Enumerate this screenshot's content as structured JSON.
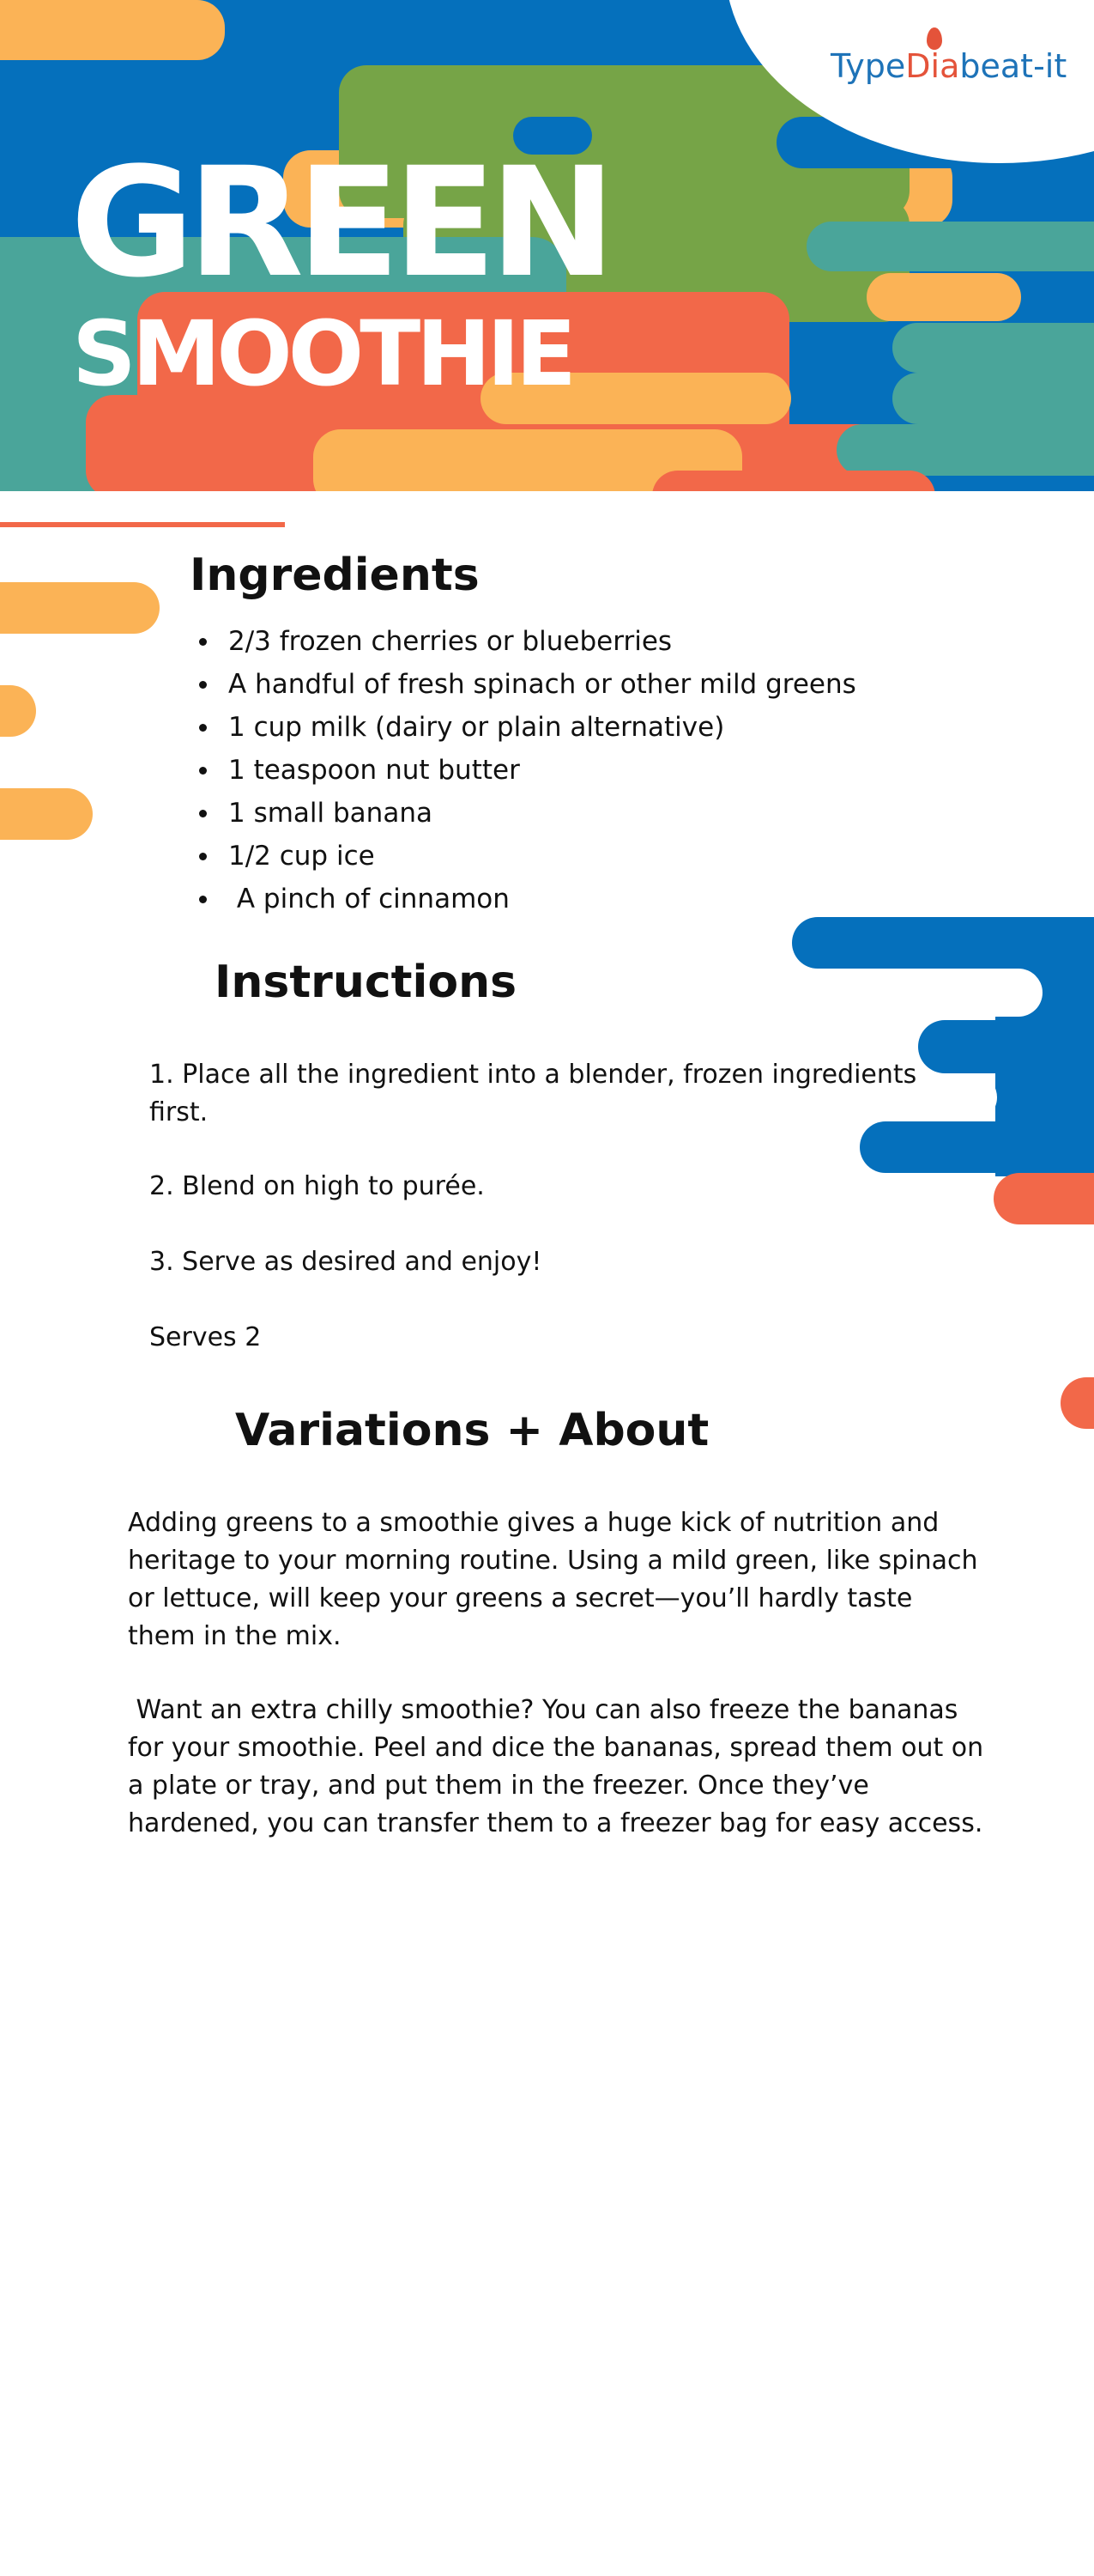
{
  "header": {
    "logo": {
      "part1": "Type",
      "part2": "Dia",
      "part3": "beat-it"
    },
    "title_line1": "GREEN",
    "title_line2": "SMOOTHIE"
  },
  "ingredients": {
    "heading": "Ingredients",
    "items": [
      "2/3 frozen cherries or blueberries",
      "A handful of fresh spinach or other mild greens",
      "1 cup milk (dairy or plain alternative)",
      "1 teaspoon nut butter",
      "1 small banana",
      "1/2 cup ice",
      " A pinch of cinnamon"
    ]
  },
  "instructions": {
    "heading": "Instructions",
    "step1": "1. Place all the ingredient into a blender, frozen ingredients first.",
    "step2": "2. Blend on high to purée.",
    "step3": "3. Serve as desired and enjoy!",
    "serves": "Serves 2"
  },
  "variations": {
    "heading": "Variations + About",
    "paragraph1": "Adding greens to a smoothie gives a huge kick of nutrition and heritage to your morning routine. Using a mild green, like spinach or lettuce, will keep your greens a secret—you’ll hardly taste them in the mix.",
    "paragraph2": " Want an extra chilly smoothie? You can also freeze the bananas for your smoothie. Peel and dice the bananas, spread them out on a plate or tray, and put them in the freezer. Once they’ve hardened, you can transfer them to a freezer bag for easy access."
  },
  "colors": {
    "blue": "#0570bc",
    "green": "#76a447",
    "teal": "#4aa59a",
    "orange": "#fbb356",
    "coral": "#f26849"
  }
}
